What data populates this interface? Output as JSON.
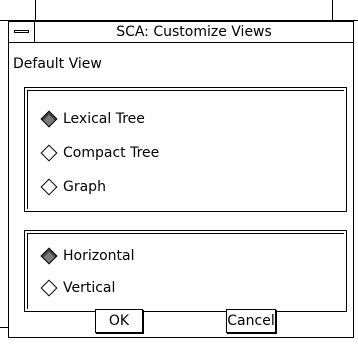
{
  "window": {
    "title": "SCA: Customize Views"
  },
  "default_view": {
    "label": "Default View",
    "view_options": [
      {
        "label": "Lexical Tree",
        "selected": true
      },
      {
        "label": "Compact Tree",
        "selected": false
      },
      {
        "label": "Graph",
        "selected": false
      }
    ],
    "orientation_options": [
      {
        "label": "Horizontal",
        "selected": true
      },
      {
        "label": "Vertical",
        "selected": false
      }
    ]
  },
  "buttons": {
    "ok": "OK",
    "cancel": "Cancel"
  },
  "icons": {
    "window_menu": "window-menu-icon",
    "radio": "diamond-radio-icon"
  },
  "colors": {
    "background": "#ffffff",
    "border": "#000000",
    "radio_selected": "#7a7a7a"
  }
}
